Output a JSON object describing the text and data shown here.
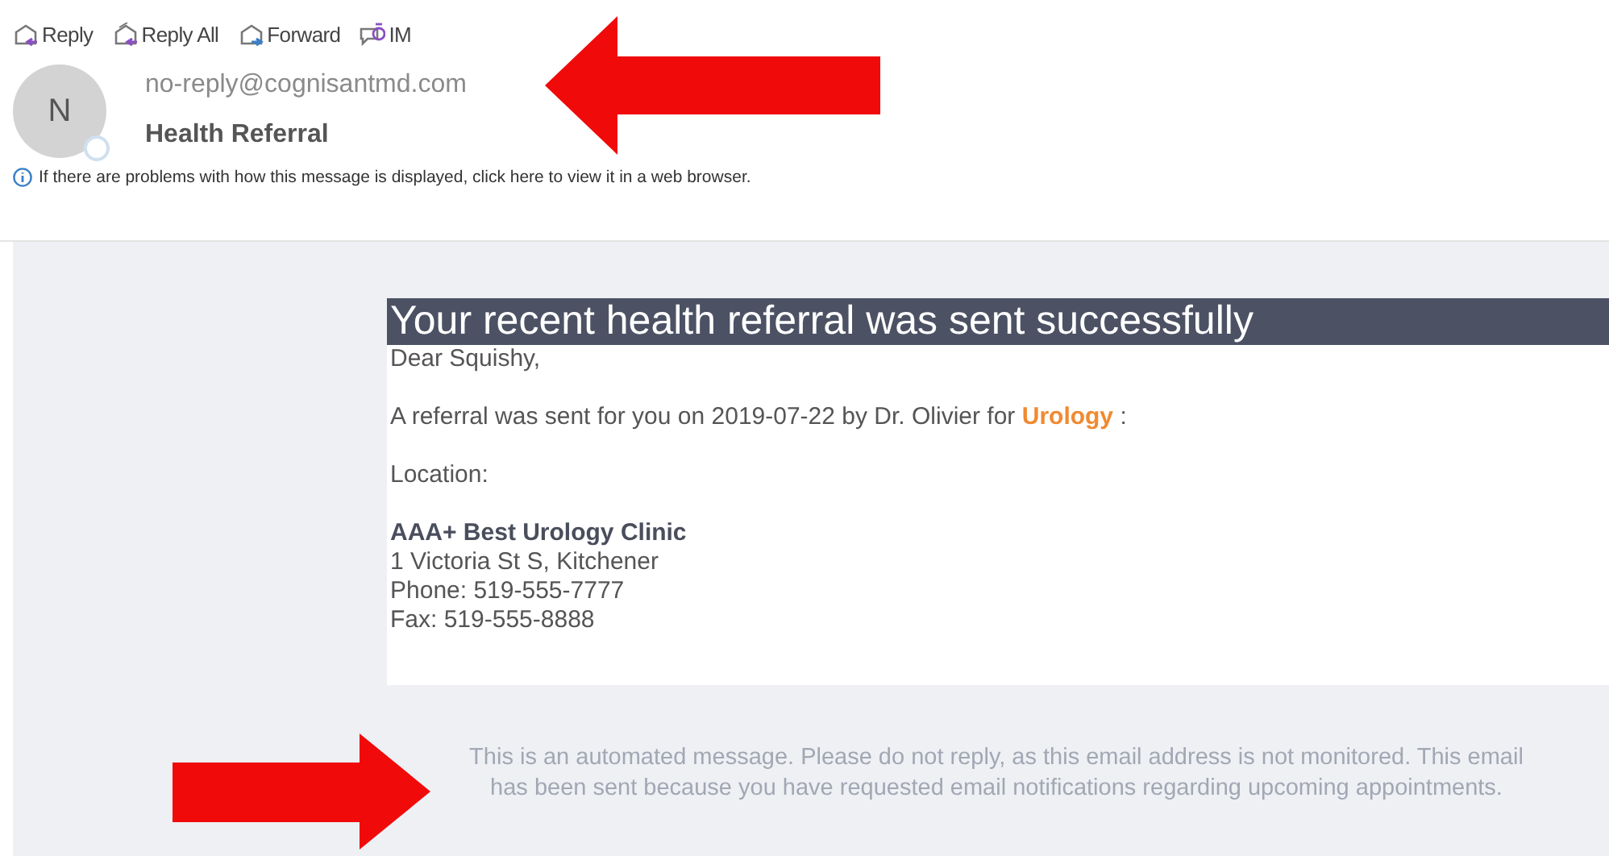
{
  "toolbar": [
    {
      "label": "Reply",
      "kind": "reply"
    },
    {
      "label": "Reply All",
      "kind": "reply-all"
    },
    {
      "label": "Forward",
      "kind": "forward"
    },
    {
      "label": "IM",
      "kind": "im"
    }
  ],
  "sender": {
    "avatar": "N",
    "address": "no-reply@cognisantmd.com"
  },
  "subject": "Health Referral",
  "info_bar": "If there are problems with how this message is displayed, click here to view it in a web browser.",
  "message": {
    "heading": "Your recent health referral was sent successfully",
    "greeting": "Dear Squishy,",
    "referral_line": "A referral was sent for you on 2019-07-22 by Dr. Olivier for **Urology** :",
    "location_label": "Location:",
    "clinic": {
      "name": "AAA+ Best Urology Clinic",
      "lines": [
        "1 Victoria St S, Kitchener",
        "Phone: 519-555-7777",
        "Fax: 519-555-8888"
      ]
    }
  },
  "footer": "This is an automated message. Please do not reply, as this email address is not monitored. This email has been sent because you have requested email notifications regarding upcoming appointments."
}
